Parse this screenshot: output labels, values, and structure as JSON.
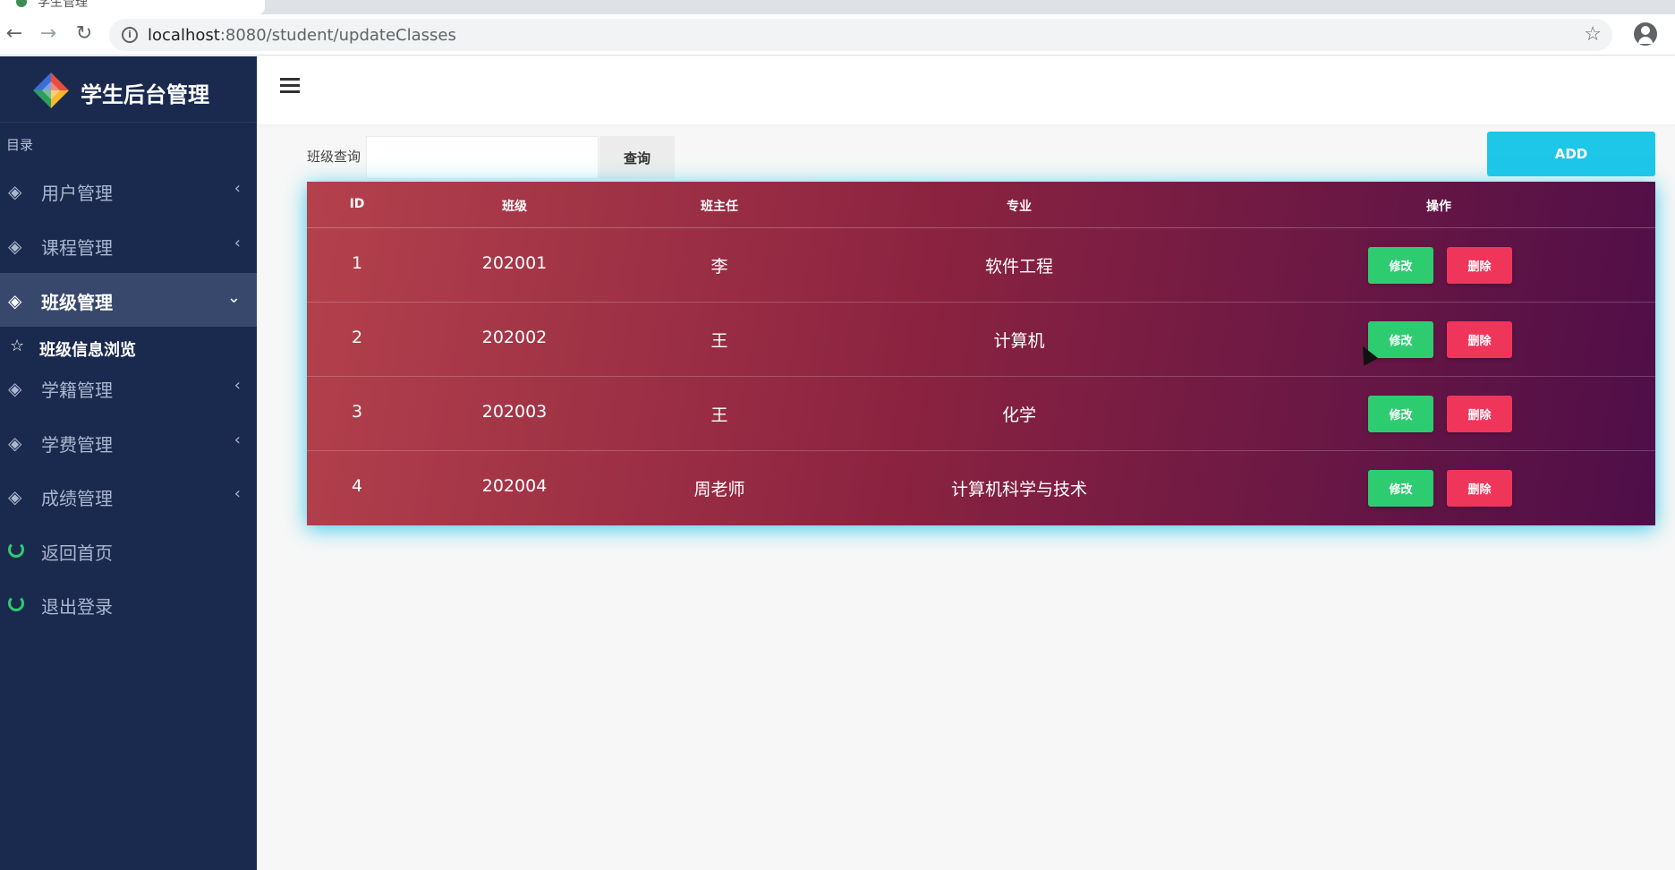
{
  "browser": {
    "tab_title": "学生管理",
    "url_host": "localhost",
    "url_path": ":8080/student/updateClasses"
  },
  "sidebar": {
    "brand": "学生后台管理",
    "heading": "目录",
    "items": [
      {
        "label": "用户管理",
        "icon": "layers-icon",
        "caret": "‹"
      },
      {
        "label": "课程管理",
        "icon": "layers-icon",
        "caret": "‹"
      },
      {
        "label": "班级管理",
        "icon": "layers-icon",
        "caret": "⌄"
      },
      {
        "label": "学籍管理",
        "icon": "layers-icon",
        "caret": "‹"
      },
      {
        "label": "学费管理",
        "icon": "layers-icon",
        "caret": "‹"
      },
      {
        "label": "成绩管理",
        "icon": "layers-icon",
        "caret": "‹"
      },
      {
        "label": "返回首页",
        "icon": "ring-icon"
      },
      {
        "label": "退出登录",
        "icon": "ring-icon"
      }
    ],
    "sub_item": {
      "label": "班级信息浏览",
      "icon": "star-icon"
    }
  },
  "search": {
    "label": "班级查询",
    "value": "",
    "query_label": "查询",
    "add_label": "ADD"
  },
  "table": {
    "columns": [
      "ID",
      "班级",
      "班主任",
      "专业",
      "操作"
    ],
    "rows": [
      {
        "id": "1",
        "class": "202001",
        "teacher": "李",
        "major": "软件工程"
      },
      {
        "id": "2",
        "class": "202002",
        "teacher": "王",
        "major": "计算机"
      },
      {
        "id": "3",
        "class": "202003",
        "teacher": "王",
        "major": "化学"
      },
      {
        "id": "4",
        "class": "202004",
        "teacher": "周老师",
        "major": "计算机科学与技术"
      }
    ],
    "edit_label": "修改",
    "delete_label": "删除"
  },
  "colors": {
    "sidebar_bg": "#1a2a4e",
    "sidebar_active": "#37486c",
    "accent_add": "#1ec6e8",
    "edit": "#2ecc71",
    "delete": "#f0355a"
  }
}
